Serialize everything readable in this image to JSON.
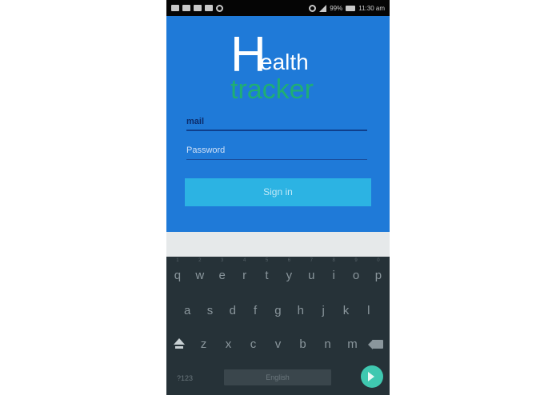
{
  "status_bar": {
    "battery": "99%",
    "time": "11:30 am",
    "icons": [
      "notification-icon",
      "message-icon",
      "video-icon",
      "gallery-icon",
      "sync-icon",
      "wifi-icon",
      "signal-icon",
      "battery-icon"
    ]
  },
  "app": {
    "logo": {
      "initial": "H",
      "rest": "ealth",
      "subtitle": "tracker"
    },
    "mail_value": "mail",
    "password_placeholder": "Password",
    "sign_in_label": "Sign in"
  },
  "keyboard": {
    "number_hints": [
      "1",
      "2",
      "3",
      "4",
      "5",
      "6",
      "7",
      "8",
      "9",
      "0"
    ],
    "row1": [
      "q",
      "w",
      "e",
      "r",
      "t",
      "y",
      "u",
      "i",
      "o",
      "p"
    ],
    "row2": [
      "a",
      "s",
      "d",
      "f",
      "g",
      "h",
      "j",
      "k",
      "l"
    ],
    "row3": [
      "z",
      "x",
      "c",
      "v",
      "b",
      "n",
      "m"
    ],
    "symbols_label": "?123",
    "space_label": "English"
  },
  "colors": {
    "app_background": "#1f7ad8",
    "logo_green": "#1fae74",
    "button": "#2cb3e3",
    "keyboard": "#263238",
    "enter": "#3fc8b0"
  }
}
